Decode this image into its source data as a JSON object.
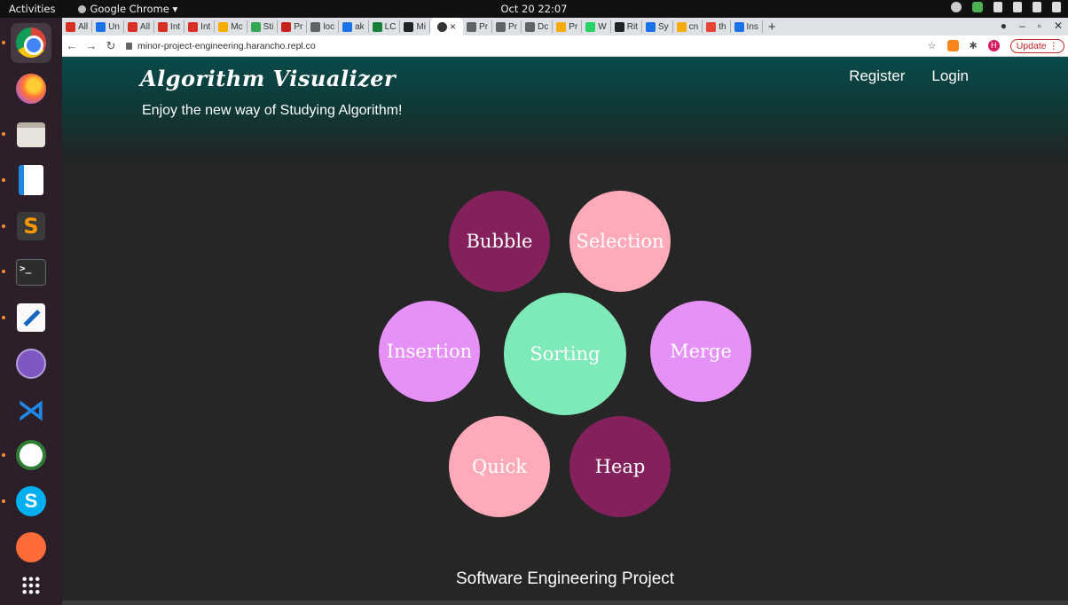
{
  "os": {
    "activities": "Activities",
    "app_menu": "Google Chrome ▾",
    "clock": "Oct 20  22:07"
  },
  "browser": {
    "tabs": [
      {
        "label": "All",
        "color": "#d93025"
      },
      {
        "label": "Un",
        "color": "#1a73e8"
      },
      {
        "label": "All",
        "color": "#d93025"
      },
      {
        "label": "Int",
        "color": "#d93025"
      },
      {
        "label": "Int",
        "color": "#d93025"
      },
      {
        "label": "Mc",
        "color": "#f9ab00"
      },
      {
        "label": "Sti",
        "color": "#34a853"
      },
      {
        "label": "Pr",
        "color": "#c5221f"
      },
      {
        "label": "loc",
        "color": "#5f6368"
      },
      {
        "label": "ak",
        "color": "#1a73e8"
      },
      {
        "label": "LC",
        "color": "#188038"
      },
      {
        "label": "Mi",
        "color": "#202124"
      }
    ],
    "tabs_after": [
      {
        "label": "Pr",
        "color": "#5f6368"
      },
      {
        "label": "Pr",
        "color": "#5f6368"
      },
      {
        "label": "Dc",
        "color": "#5f6368"
      },
      {
        "label": "Pr",
        "color": "#f9ab00"
      },
      {
        "label": "W",
        "color": "#25d366"
      },
      {
        "label": "Rit",
        "color": "#202124"
      },
      {
        "label": "Sy",
        "color": "#1a73e8"
      },
      {
        "label": "cn",
        "color": "#f9ab00"
      },
      {
        "label": "th",
        "color": "#ea4335"
      },
      {
        "label": "Ins",
        "color": "#1a73e8"
      }
    ],
    "active_tab_close": "×",
    "new_tab": "+",
    "url": "minor-project-engineering.harancho.repl.co",
    "update_label": "Update",
    "avatar_letter": "H"
  },
  "site": {
    "brand": "Algorithm Visualizer",
    "tagline": "Enjoy the new way of Studying Algorithm!",
    "nav": {
      "register": "Register",
      "login": "Login"
    },
    "circles": {
      "bubble": {
        "label": "Bubble",
        "color": "#84205c"
      },
      "selection": {
        "label": "Selection",
        "color": "#ffaab8"
      },
      "insertion": {
        "label": "Insertion",
        "color": "#e691f7"
      },
      "sorting": {
        "label": "Sorting",
        "color": "#7deab7"
      },
      "merge": {
        "label": "Merge",
        "color": "#e691f7"
      },
      "quick": {
        "label": "Quick",
        "color": "#ffaab8"
      },
      "heap": {
        "label": "Heap",
        "color": "#84205c"
      }
    },
    "footer": "Software Engineering Project"
  }
}
